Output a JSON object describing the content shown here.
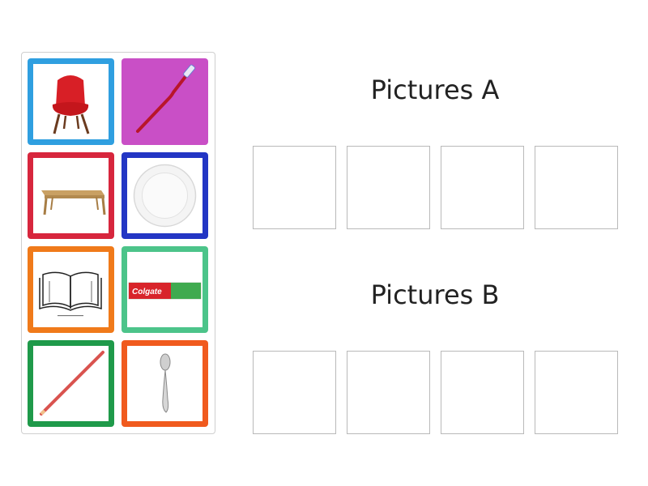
{
  "groups": [
    {
      "title": "Pictures A",
      "slots": 4
    },
    {
      "title": "Pictures B",
      "slots": 4
    }
  ],
  "cards": [
    {
      "item": "chair",
      "frame_color": "#2f9fe0",
      "icon": "chair-icon"
    },
    {
      "item": "toothbrush",
      "frame_color": "#c94fc6",
      "icon": "toothbrush-icon"
    },
    {
      "item": "table",
      "frame_color": "#d7263d",
      "icon": "table-icon"
    },
    {
      "item": "plate",
      "frame_color": "#2336c4",
      "icon": "plate-icon"
    },
    {
      "item": "book",
      "frame_color": "#f07a1a",
      "icon": "book-icon"
    },
    {
      "item": "toothpaste",
      "frame_color": "#4cc48a",
      "icon": "toothpaste-icon",
      "brand": "Colgate"
    },
    {
      "item": "pencil",
      "frame_color": "#1f9a4a",
      "icon": "pencil-icon"
    },
    {
      "item": "spoon",
      "frame_color": "#f05a1e",
      "icon": "spoon-icon"
    }
  ]
}
